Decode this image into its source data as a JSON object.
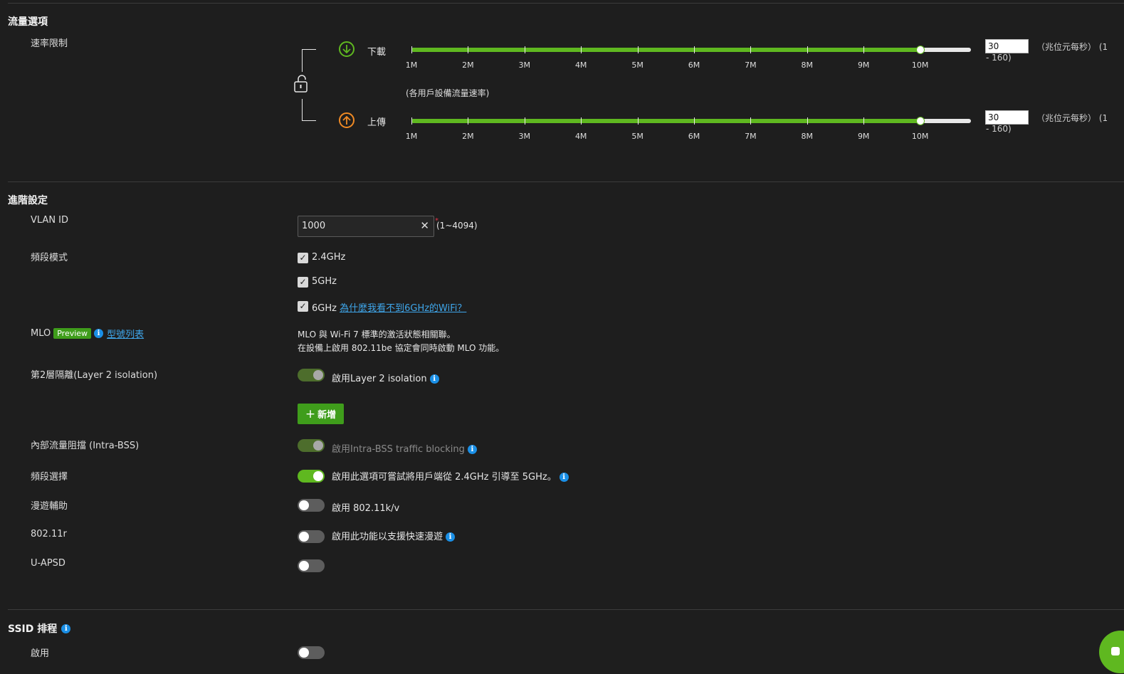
{
  "traffic": {
    "title": "流量選項",
    "rate_limit_label": "速率限制",
    "download_label": "下載",
    "upload_label": "上傳",
    "per_client_note": "(各用戶設備流量速率)",
    "ticks": [
      "1M",
      "2M",
      "3M",
      "4M",
      "5M",
      "6M",
      "7M",
      "8M",
      "9M",
      "10M"
    ],
    "download_value": "30",
    "upload_value": "30",
    "unit": "（兆位元每秒） (1",
    "range": "- 160)",
    "slider_level": 0.91
  },
  "advanced": {
    "title": "進階設定",
    "vlan_label": "VLAN ID",
    "vlan_value": "1000",
    "vlan_range": "(1~4094)",
    "band_mode_label": "頻段模式",
    "band_24": "2.4GHz",
    "band_5": "5GHz",
    "band_6": "6GHz",
    "band_6_link": "為什麼我看不到6GHz的WiFi？",
    "mlo_label": "MLO",
    "mlo_badge": "Preview",
    "mlo_link": "型號列表",
    "mlo_desc_1": "MLO 與 Wi-Fi 7 標準的激活狀態相關聯。",
    "mlo_desc_2": "在設備上啟用 802.11be 協定會同時啟動 MLO 功能。",
    "l2_label": "第2層隔離(Layer 2 isolation)",
    "l2_toggle_label": "啟用Layer 2 isolation",
    "add_button": "新增",
    "intra_label": "內部流量阻擋 (Intra-BSS)",
    "intra_toggle_label": "啟用Intra-BSS traffic blocking",
    "band_select_label": "頻段選擇",
    "band_select_toggle_label": "啟用此選項可嘗試將用戶端從 2.4GHz 引導至 5GHz。",
    "roaming_label": "漫遊輔助",
    "roaming_toggle_label": "啟用 802.11k/v",
    "r_label": "802.11r",
    "r_toggle_label": "啟用此功能以支援快速漫遊",
    "uapsd_label": "U-APSD"
  },
  "schedule": {
    "title": "SSID 排程",
    "enable_label": "啟用"
  },
  "colors": {
    "accent": "#5fb820",
    "upload": "#f08a24",
    "info": "#1a8fe6",
    "background": "#1e1e1e"
  }
}
